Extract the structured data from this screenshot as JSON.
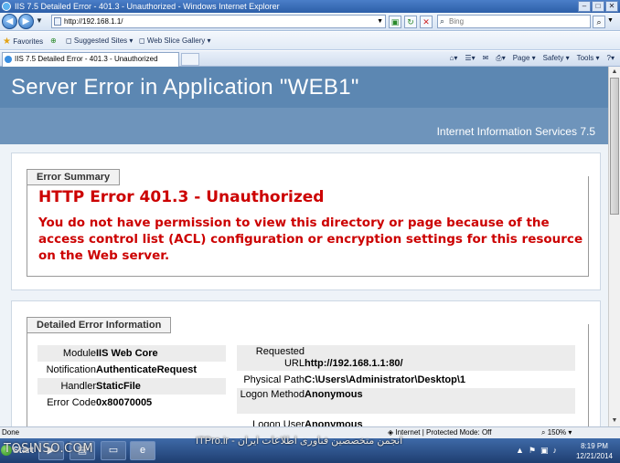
{
  "window": {
    "title": "IIS 7.5 Detailed Error - 401.3 - Unauthorized - Windows Internet Explorer"
  },
  "address_bar": {
    "url": "http://192.168.1.1/",
    "search_placeholder": "Bing"
  },
  "favorites_bar": {
    "favorites": "Favorites",
    "suggested": "Suggested Sites",
    "gallery": "Web Slice Gallery"
  },
  "tabs": [
    {
      "label": "IIS 7.5 Detailed Error - 401.3 - Unauthorized"
    }
  ],
  "command_bar": {
    "page": "Page",
    "safety": "Safety",
    "tools": "Tools"
  },
  "page": {
    "header_title": "Server Error in Application \"WEB1\"",
    "header_sub": "Internet Information Services 7.5",
    "error_summary": {
      "legend": "Error Summary",
      "title": "HTTP Error 401.3 - Unauthorized",
      "description": "You do not have permission to view this directory or page because of the access control list (ACL) configuration or encryption settings for this resource on the Web server."
    },
    "detailed": {
      "legend": "Detailed Error Information",
      "left": [
        {
          "key": "Module",
          "value": "IIS Web Core"
        },
        {
          "key": "Notification",
          "value": "AuthenticateRequest"
        },
        {
          "key": "Handler",
          "value": "StaticFile"
        },
        {
          "key": "Error Code",
          "value": "0x80070005"
        }
      ],
      "right": [
        {
          "key": "Requested URL",
          "value": "http://192.168.1.1:80/"
        },
        {
          "key": "Physical Path",
          "value": "C:\\Users\\Administrator\\Desktop\\1"
        },
        {
          "key": "Logon Method",
          "value": "Anonymous"
        },
        {
          "key": "Logon User",
          "value": "Anonymous"
        }
      ]
    }
  },
  "status_bar": {
    "left": "Done",
    "zone": "Internet | Protected Mode: Off",
    "zoom": "150%"
  },
  "taskbar": {
    "start": "Start",
    "time": "8:19 PM",
    "date": "12/21/2014"
  },
  "watermarks": {
    "left": "TOSINSO.COM",
    "center": "ITPro.ir - انجمن متخصصین فناوری اطلاعات ایران"
  },
  "colors": {
    "header_dark": "#5c87b2",
    "header_light": "#6e94bb",
    "error_red": "#cc0000",
    "page_bg": "#eef3f8"
  }
}
